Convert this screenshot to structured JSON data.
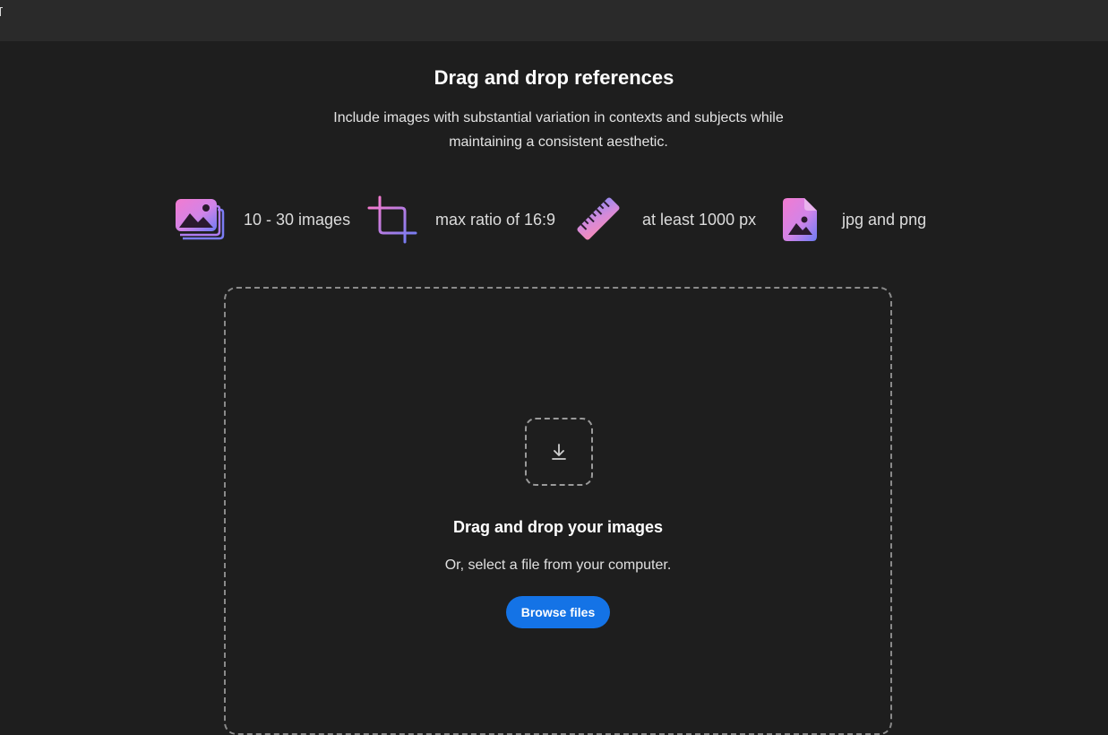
{
  "header": {
    "title": "Drag and drop references",
    "subtitle": "Include images with substantial variation in contexts and subjects while maintaining a consistent aesthetic."
  },
  "requirements": [
    {
      "icon": "image-stack-icon",
      "label": "10 - 30 images"
    },
    {
      "icon": "crop-icon",
      "label": "max ratio of 16:9"
    },
    {
      "icon": "ruler-icon",
      "label": "at least 1000 px"
    },
    {
      "icon": "image-file-icon",
      "label": "jpg and png"
    }
  ],
  "dropzone": {
    "icon": "download-icon",
    "title": "Drag and drop your images",
    "subtitle": "Or, select a file from your computer.",
    "button_label": "Browse files"
  },
  "colors": {
    "background": "#1e1e1e",
    "topbar": "#2a2a2a",
    "accent": "#1473e6",
    "gradient_start": "#f27bd0",
    "gradient_mid": "#b57cf0",
    "gradient_end": "#6d7cf4"
  }
}
